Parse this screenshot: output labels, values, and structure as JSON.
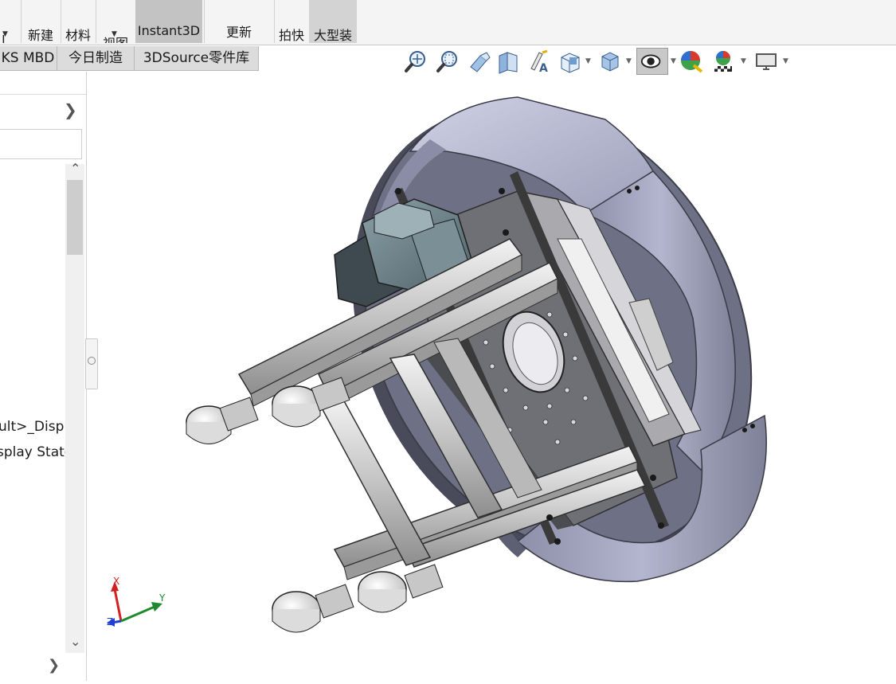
{
  "ribbon": {
    "buttons": [
      {
        "id": "cut-left",
        "label": "l...",
        "has_dropdown": true
      },
      {
        "id": "motion-study",
        "label": "新建\n运动\n算例"
      },
      {
        "id": "bom",
        "label": "材料\n明细\n表"
      },
      {
        "id": "view",
        "label": "视图",
        "has_dropdown": true
      },
      {
        "id": "instant3d",
        "label": "Instant3D",
        "active": true
      },
      {
        "id": "speedpak",
        "label": "更新\nSpeedpak"
      },
      {
        "id": "snapshot",
        "label": "拍快\n照"
      },
      {
        "id": "large-assembly",
        "label": "大型装\n配体模\n式",
        "pressed": true
      }
    ]
  },
  "tabs": [
    "KS MBD",
    "今日制造",
    "3DSource零件库"
  ],
  "left_panel": {
    "tree_lines": [
      "ult>_Displ",
      "splay State"
    ]
  },
  "hud_toolbar": {
    "icons": [
      "zoom-to-fit-icon",
      "zoom-to-area-icon",
      "previous-view-icon",
      "section-view-icon",
      "dynamic-annotation-icon",
      "view-orientation-icon",
      "display-style-icon",
      "hide-show-items-icon",
      "edit-appearance-icon",
      "apply-scene-icon",
      "view-settings-icon"
    ]
  },
  "triad": {
    "x_label": "X",
    "y_label": "Y",
    "z_label": "Z"
  },
  "colors": {
    "accent_x": "#d42020",
    "accent_y": "#1e8a2e",
    "accent_z": "#1f3fd6",
    "model_shell": "#aeb0c8",
    "model_plate": "#8d8d8d"
  }
}
